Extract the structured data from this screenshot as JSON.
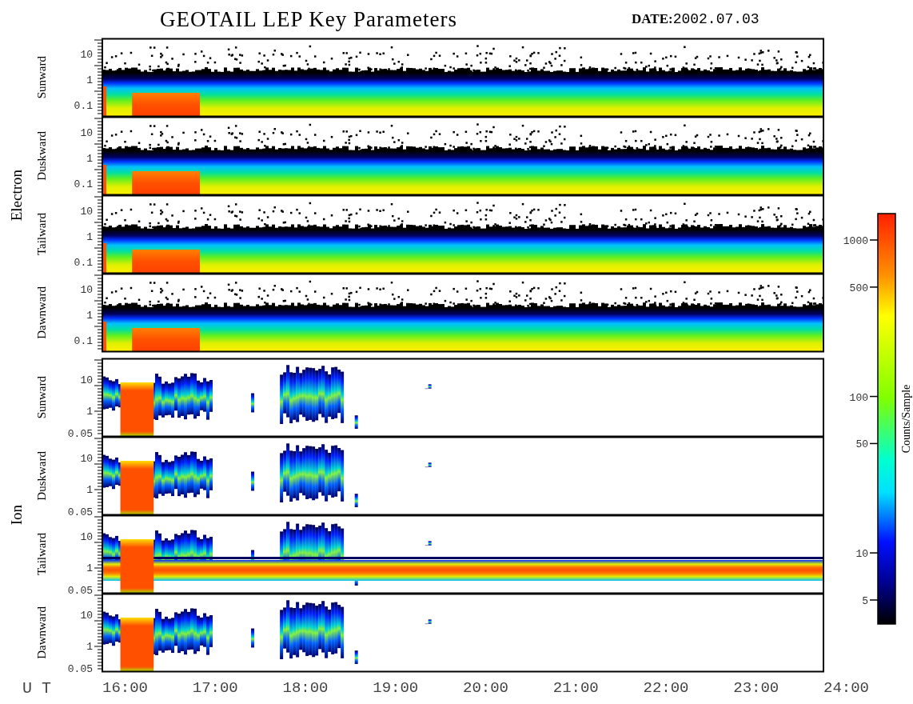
{
  "title": "GEOTAIL LEP Key Parameters",
  "date": {
    "label": "DATE:",
    "value": "2002.07.03"
  },
  "groups": [
    {
      "name": "Electron",
      "panels": [
        {
          "direction": "Sunward",
          "kind": "electron",
          "yticks": [
            "10",
            "1",
            "0.1"
          ]
        },
        {
          "direction": "Duskward",
          "kind": "electron",
          "yticks": [
            "10",
            "1",
            "0.1"
          ]
        },
        {
          "direction": "Tailward",
          "kind": "electron",
          "yticks": [
            "10",
            "1",
            "0.1"
          ]
        },
        {
          "direction": "Dawnward",
          "kind": "electron",
          "yticks": [
            "10",
            "1",
            "0.1"
          ]
        }
      ]
    },
    {
      "name": "Ion",
      "panels": [
        {
          "direction": "Sunward",
          "kind": "ion",
          "yticks": [
            "10",
            "1",
            "0.05"
          ]
        },
        {
          "direction": "Duskward",
          "kind": "ion",
          "yticks": [
            "10",
            "1",
            "0.05"
          ]
        },
        {
          "direction": "Tailward",
          "kind": "ion-band",
          "yticks": [
            "10",
            "1",
            "0.05"
          ]
        },
        {
          "direction": "Dawnward",
          "kind": "ion",
          "yticks": [
            "10",
            "1",
            "0.05"
          ]
        }
      ]
    }
  ],
  "xaxis": {
    "label": "U T",
    "ticks": [
      "16:00",
      "17:00",
      "18:00",
      "19:00",
      "20:00",
      "21:00",
      "22:00",
      "23:00",
      "24:00"
    ]
  },
  "colorbar": {
    "title": "Counts/Sample",
    "ticks": [
      "1000",
      "500",
      "100",
      "50",
      "10",
      "5"
    ]
  }
}
